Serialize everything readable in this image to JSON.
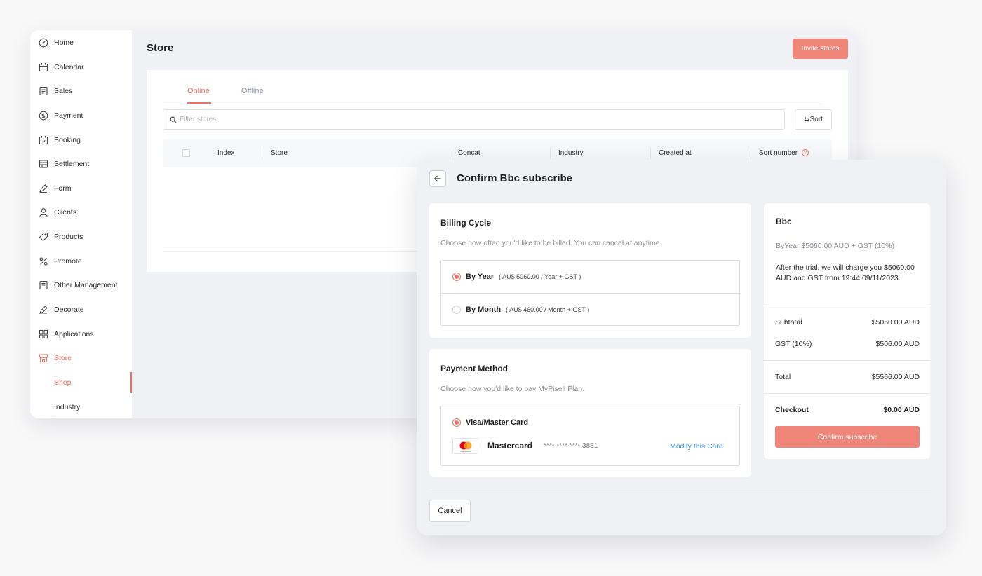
{
  "sidebar": {
    "items": [
      {
        "label": "Home",
        "icon": "dashboard-icon"
      },
      {
        "label": "Calendar",
        "icon": "calendar-icon"
      },
      {
        "label": "Sales",
        "icon": "receipt-icon"
      },
      {
        "label": "Payment",
        "icon": "dollar-circle-icon"
      },
      {
        "label": "Booking",
        "icon": "booking-icon"
      },
      {
        "label": "Settlement",
        "icon": "settlement-icon"
      },
      {
        "label": "Form",
        "icon": "form-icon"
      },
      {
        "label": "Clients",
        "icon": "user-icon"
      },
      {
        "label": "Products",
        "icon": "tag-icon"
      },
      {
        "label": "Promote",
        "icon": "percent-icon"
      },
      {
        "label": "Other Management",
        "icon": "document-icon"
      },
      {
        "label": "Decorate",
        "icon": "brush-icon"
      },
      {
        "label": "Applications",
        "icon": "grid-icon"
      },
      {
        "label": "Store",
        "icon": "store-icon"
      }
    ],
    "sub_items": [
      {
        "label": "Shop"
      },
      {
        "label": "Industry"
      }
    ]
  },
  "main": {
    "title": "Store",
    "invite_label": "Invite stores",
    "tabs": [
      {
        "label": "Online"
      },
      {
        "label": "Offline"
      }
    ],
    "search_placeholder": "Filter stores",
    "sort_label": "⇆Sort",
    "columns": [
      "Index",
      "Store",
      "Concat",
      "Industry",
      "Created at",
      "Sort number"
    ],
    "help_glyph": "?"
  },
  "modal": {
    "title": "Confirm Bbc subscribe",
    "billing": {
      "title": "Billing Cycle",
      "desc": "Choose how often you'd like to be billed. You can cancel at anytime.",
      "options": [
        {
          "label": "By Year",
          "detail": "( AU$ 5060.00 / Year + GST )",
          "selected": true
        },
        {
          "label": "By Month",
          "detail": "( AU$ 460.00 / Month + GST )",
          "selected": false
        }
      ]
    },
    "payment": {
      "title": "Payment Method",
      "desc": "Choose how you'd like to pay MyPisell Plan.",
      "option_label": "Visa/Master Card",
      "card_name": "Mastercard",
      "card_number": "**** **** **** 3881",
      "modify_label": "Modify this Card",
      "logo_text": "mastercard"
    },
    "summary": {
      "title": "Bbc",
      "plan": "ByYear $5060.00 AUD + GST (10%)",
      "note": "After the trial, we will charge you $5060.00 AUD and GST from 19:44 09/11/2023.",
      "subtotal_label": "Subtotal",
      "subtotal_value": "$5060.00 AUD",
      "gst_label": "GST (10%)",
      "gst_value": "$506.00 AUD",
      "total_label": "Total",
      "total_value": "$5566.00 AUD",
      "checkout_label": "Checkout",
      "checkout_value": "$0.00 AUD",
      "confirm_label": "Confirm subscribe"
    },
    "cancel_label": "Cancel"
  },
  "colors": {
    "accent": "#ee6e5f",
    "button_fill": "#f0857a",
    "link": "#3a8ee6"
  }
}
